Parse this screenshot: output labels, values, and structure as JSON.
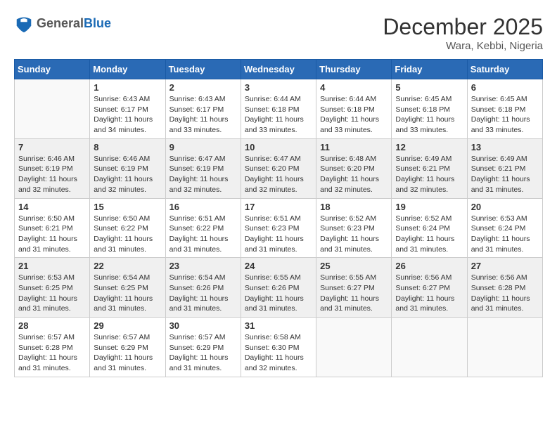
{
  "header": {
    "logo_general": "General",
    "logo_blue": "Blue",
    "month_year": "December 2025",
    "location": "Wara, Kebbi, Nigeria"
  },
  "days_of_week": [
    "Sunday",
    "Monday",
    "Tuesday",
    "Wednesday",
    "Thursday",
    "Friday",
    "Saturday"
  ],
  "weeks": [
    [
      {
        "day": "",
        "sunrise": "",
        "sunset": "",
        "daylight": ""
      },
      {
        "day": "1",
        "sunrise": "Sunrise: 6:43 AM",
        "sunset": "Sunset: 6:17 PM",
        "daylight": "Daylight: 11 hours and 34 minutes."
      },
      {
        "day": "2",
        "sunrise": "Sunrise: 6:43 AM",
        "sunset": "Sunset: 6:17 PM",
        "daylight": "Daylight: 11 hours and 33 minutes."
      },
      {
        "day": "3",
        "sunrise": "Sunrise: 6:44 AM",
        "sunset": "Sunset: 6:18 PM",
        "daylight": "Daylight: 11 hours and 33 minutes."
      },
      {
        "day": "4",
        "sunrise": "Sunrise: 6:44 AM",
        "sunset": "Sunset: 6:18 PM",
        "daylight": "Daylight: 11 hours and 33 minutes."
      },
      {
        "day": "5",
        "sunrise": "Sunrise: 6:45 AM",
        "sunset": "Sunset: 6:18 PM",
        "daylight": "Daylight: 11 hours and 33 minutes."
      },
      {
        "day": "6",
        "sunrise": "Sunrise: 6:45 AM",
        "sunset": "Sunset: 6:18 PM",
        "daylight": "Daylight: 11 hours and 33 minutes."
      }
    ],
    [
      {
        "day": "7",
        "sunrise": "Sunrise: 6:46 AM",
        "sunset": "Sunset: 6:19 PM",
        "daylight": "Daylight: 11 hours and 32 minutes."
      },
      {
        "day": "8",
        "sunrise": "Sunrise: 6:46 AM",
        "sunset": "Sunset: 6:19 PM",
        "daylight": "Daylight: 11 hours and 32 minutes."
      },
      {
        "day": "9",
        "sunrise": "Sunrise: 6:47 AM",
        "sunset": "Sunset: 6:19 PM",
        "daylight": "Daylight: 11 hours and 32 minutes."
      },
      {
        "day": "10",
        "sunrise": "Sunrise: 6:47 AM",
        "sunset": "Sunset: 6:20 PM",
        "daylight": "Daylight: 11 hours and 32 minutes."
      },
      {
        "day": "11",
        "sunrise": "Sunrise: 6:48 AM",
        "sunset": "Sunset: 6:20 PM",
        "daylight": "Daylight: 11 hours and 32 minutes."
      },
      {
        "day": "12",
        "sunrise": "Sunrise: 6:49 AM",
        "sunset": "Sunset: 6:21 PM",
        "daylight": "Daylight: 11 hours and 32 minutes."
      },
      {
        "day": "13",
        "sunrise": "Sunrise: 6:49 AM",
        "sunset": "Sunset: 6:21 PM",
        "daylight": "Daylight: 11 hours and 31 minutes."
      }
    ],
    [
      {
        "day": "14",
        "sunrise": "Sunrise: 6:50 AM",
        "sunset": "Sunset: 6:21 PM",
        "daylight": "Daylight: 11 hours and 31 minutes."
      },
      {
        "day": "15",
        "sunrise": "Sunrise: 6:50 AM",
        "sunset": "Sunset: 6:22 PM",
        "daylight": "Daylight: 11 hours and 31 minutes."
      },
      {
        "day": "16",
        "sunrise": "Sunrise: 6:51 AM",
        "sunset": "Sunset: 6:22 PM",
        "daylight": "Daylight: 11 hours and 31 minutes."
      },
      {
        "day": "17",
        "sunrise": "Sunrise: 6:51 AM",
        "sunset": "Sunset: 6:23 PM",
        "daylight": "Daylight: 11 hours and 31 minutes."
      },
      {
        "day": "18",
        "sunrise": "Sunrise: 6:52 AM",
        "sunset": "Sunset: 6:23 PM",
        "daylight": "Daylight: 11 hours and 31 minutes."
      },
      {
        "day": "19",
        "sunrise": "Sunrise: 6:52 AM",
        "sunset": "Sunset: 6:24 PM",
        "daylight": "Daylight: 11 hours and 31 minutes."
      },
      {
        "day": "20",
        "sunrise": "Sunrise: 6:53 AM",
        "sunset": "Sunset: 6:24 PM",
        "daylight": "Daylight: 11 hours and 31 minutes."
      }
    ],
    [
      {
        "day": "21",
        "sunrise": "Sunrise: 6:53 AM",
        "sunset": "Sunset: 6:25 PM",
        "daylight": "Daylight: 11 hours and 31 minutes."
      },
      {
        "day": "22",
        "sunrise": "Sunrise: 6:54 AM",
        "sunset": "Sunset: 6:25 PM",
        "daylight": "Daylight: 11 hours and 31 minutes."
      },
      {
        "day": "23",
        "sunrise": "Sunrise: 6:54 AM",
        "sunset": "Sunset: 6:26 PM",
        "daylight": "Daylight: 11 hours and 31 minutes."
      },
      {
        "day": "24",
        "sunrise": "Sunrise: 6:55 AM",
        "sunset": "Sunset: 6:26 PM",
        "daylight": "Daylight: 11 hours and 31 minutes."
      },
      {
        "day": "25",
        "sunrise": "Sunrise: 6:55 AM",
        "sunset": "Sunset: 6:27 PM",
        "daylight": "Daylight: 11 hours and 31 minutes."
      },
      {
        "day": "26",
        "sunrise": "Sunrise: 6:56 AM",
        "sunset": "Sunset: 6:27 PM",
        "daylight": "Daylight: 11 hours and 31 minutes."
      },
      {
        "day": "27",
        "sunrise": "Sunrise: 6:56 AM",
        "sunset": "Sunset: 6:28 PM",
        "daylight": "Daylight: 11 hours and 31 minutes."
      }
    ],
    [
      {
        "day": "28",
        "sunrise": "Sunrise: 6:57 AM",
        "sunset": "Sunset: 6:28 PM",
        "daylight": "Daylight: 11 hours and 31 minutes."
      },
      {
        "day": "29",
        "sunrise": "Sunrise: 6:57 AM",
        "sunset": "Sunset: 6:29 PM",
        "daylight": "Daylight: 11 hours and 31 minutes."
      },
      {
        "day": "30",
        "sunrise": "Sunrise: 6:57 AM",
        "sunset": "Sunset: 6:29 PM",
        "daylight": "Daylight: 11 hours and 31 minutes."
      },
      {
        "day": "31",
        "sunrise": "Sunrise: 6:58 AM",
        "sunset": "Sunset: 6:30 PM",
        "daylight": "Daylight: 11 hours and 32 minutes."
      },
      {
        "day": "",
        "sunrise": "",
        "sunset": "",
        "daylight": ""
      },
      {
        "day": "",
        "sunrise": "",
        "sunset": "",
        "daylight": ""
      },
      {
        "day": "",
        "sunrise": "",
        "sunset": "",
        "daylight": ""
      }
    ]
  ]
}
